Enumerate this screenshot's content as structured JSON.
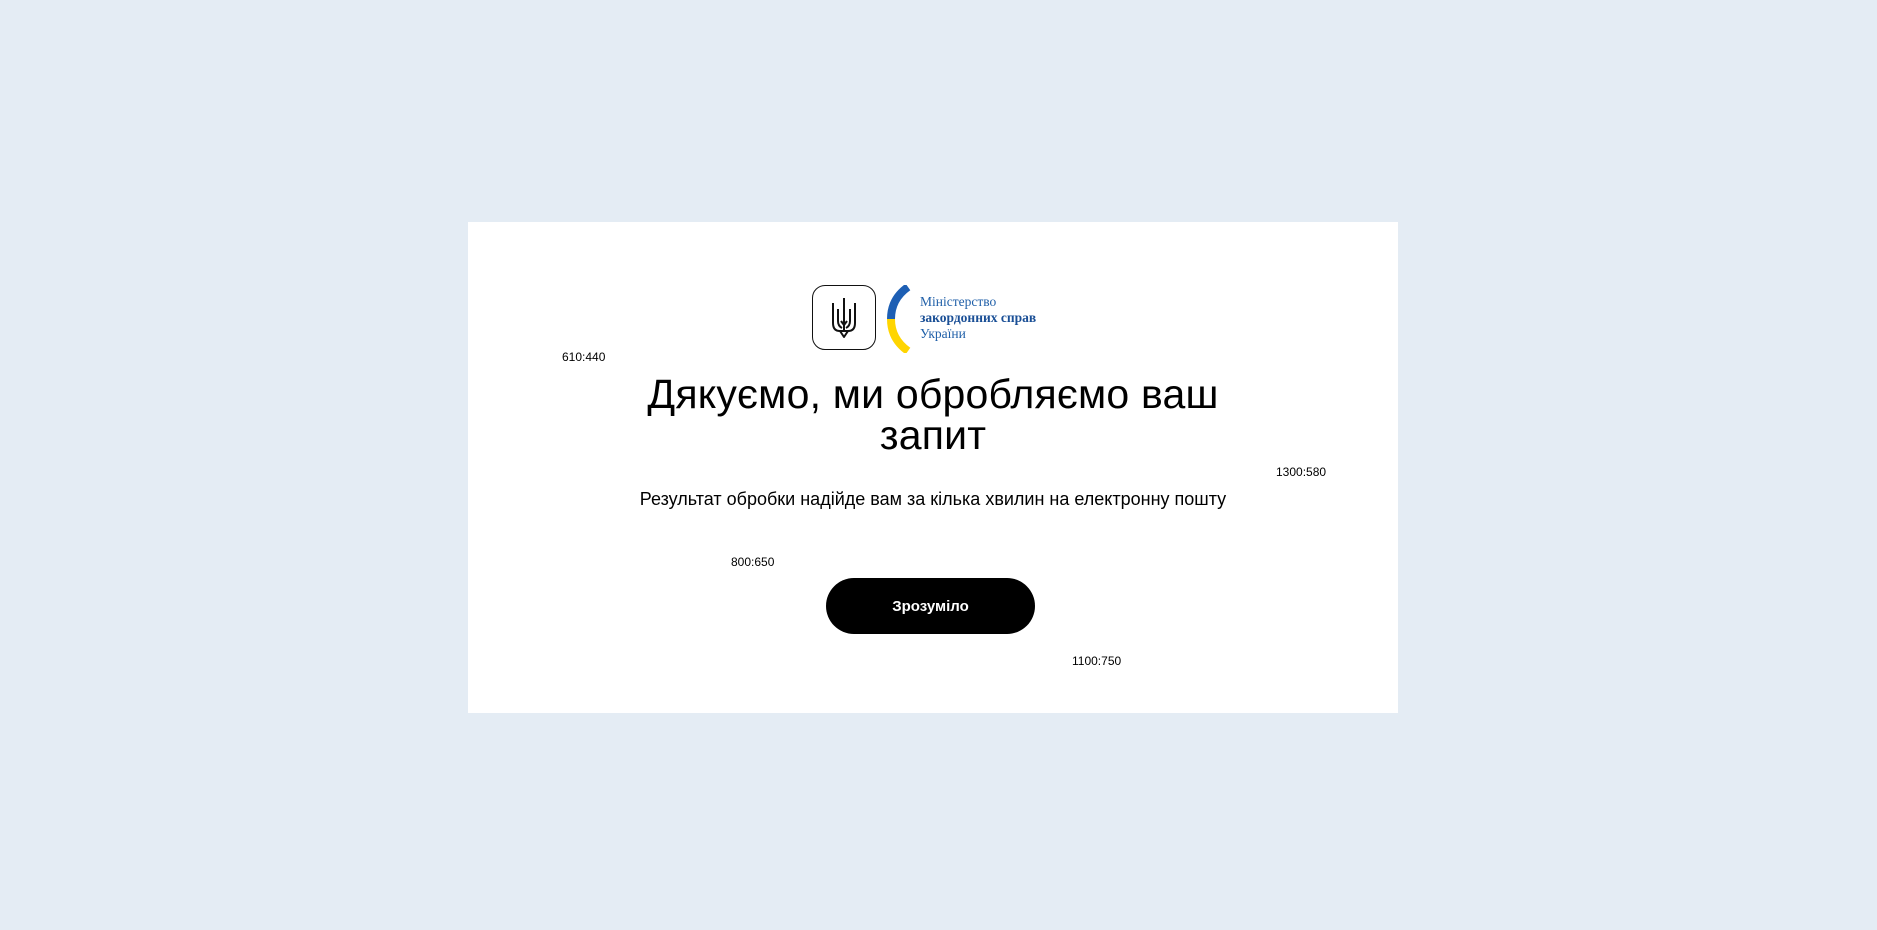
{
  "logo": {
    "line1": "Міністерство",
    "line2": "закордонних справ",
    "line3": "України",
    "colors": {
      "blue": "#1d5fb4",
      "yellow": "#ffd500",
      "text": "#1f5fa8"
    }
  },
  "title": "Дякуємо, ми обробляємо ваш запит",
  "subtitle": "Результат обробки надійде вам за кілька хвилин на електронну пошту",
  "button": {
    "label": "Зрозуміло"
  },
  "debug_labels": [
    "610:440",
    "1300:580",
    "800:650",
    "1100:750"
  ]
}
